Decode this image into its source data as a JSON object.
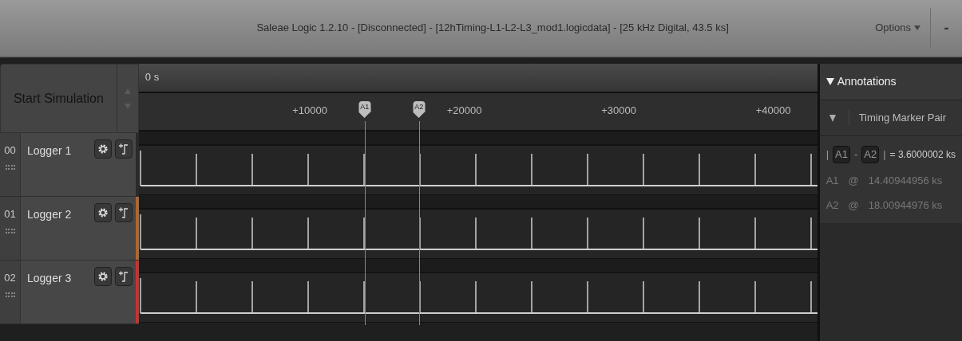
{
  "window": {
    "title": "Saleae Logic 1.2.10 - [Disconnected] - [12hTiming-L1-L2-L3_mod1.logicdata] - [25 kHz Digital, 43.5 ks]",
    "options": "Options",
    "minimize": "-"
  },
  "simulation": {
    "label": "Start Simulation",
    "disabled": true
  },
  "timeline": {
    "start": "0 s",
    "ticks": [
      {
        "label": "+10000"
      },
      {
        "label": "+20000"
      },
      {
        "label": "+30000"
      },
      {
        "label": "+40000"
      }
    ],
    "markers": [
      {
        "label": "A1"
      },
      {
        "label": "A2"
      }
    ]
  },
  "channels": [
    {
      "number": "00",
      "name": "Logger 1",
      "color": "#2a2a2a"
    },
    {
      "number": "01",
      "name": "Logger 2",
      "color": "#b5652a"
    },
    {
      "number": "02",
      "name": "Logger 3",
      "color": "#d0302a"
    }
  ],
  "annotations": {
    "title": "Annotations",
    "expanded": true,
    "group": "Timing Marker Pair",
    "measurement": {
      "open": "|",
      "first": "A1",
      "dash": "-",
      "second": "A2",
      "close": "|",
      "result": "= 3.6000002 ks"
    },
    "positions": [
      {
        "marker": "A1",
        "at": "@",
        "time": "14.40944956 ks"
      },
      {
        "marker": "A2",
        "at": "@",
        "time": "18.00944976 ks"
      }
    ]
  }
}
